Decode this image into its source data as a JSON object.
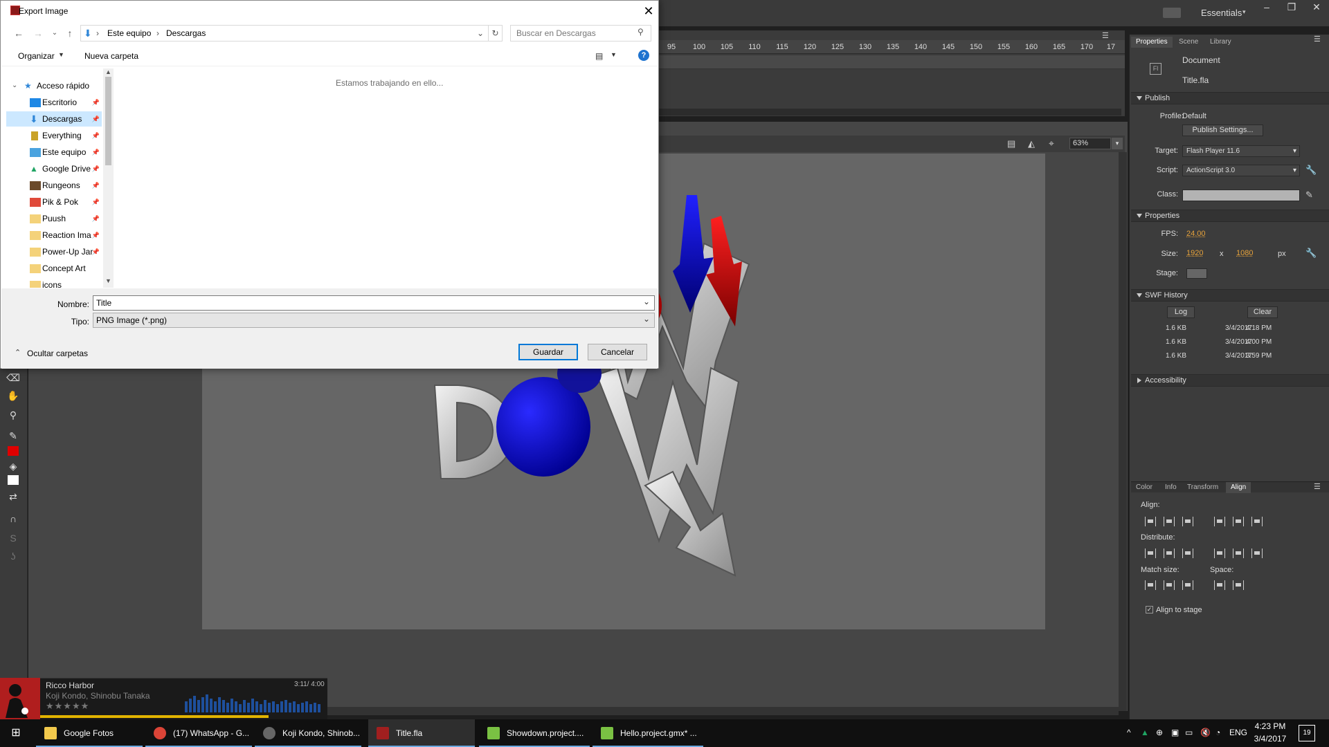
{
  "dialog": {
    "title": "Export Image",
    "breadcrumb": [
      "Este equipo",
      "Descargas"
    ],
    "search_placeholder": "Buscar en Descargas",
    "organize": "Organizar",
    "new_folder": "Nueva carpeta",
    "nav_items": [
      {
        "label": "Acceso rápido",
        "icon": "star-icon"
      },
      {
        "label": "Escritorio",
        "icon": "desktop-icon"
      },
      {
        "label": "Descargas",
        "icon": "download-icon"
      },
      {
        "label": "Everything",
        "icon": "app-icon"
      },
      {
        "label": "Este equipo",
        "icon": "computer-icon"
      },
      {
        "label": "Google Drive",
        "icon": "drive-icon"
      },
      {
        "label": "Rungeons",
        "icon": "folder-icon"
      },
      {
        "label": "Pik & Pok",
        "icon": "folder-icon"
      },
      {
        "label": "Puush",
        "icon": "folder-icon"
      },
      {
        "label": "Reaction Ima",
        "icon": "folder-icon"
      },
      {
        "label": "Power-Up Jar",
        "icon": "folder-icon"
      },
      {
        "label": "Concept Art",
        "icon": "folder-icon"
      },
      {
        "label": "icons",
        "icon": "folder-icon"
      }
    ],
    "working_text": "Estamos trabajando en ello...",
    "filename_label": "Nombre:",
    "filename_value": "Title",
    "filetype_label": "Tipo:",
    "filetype_value": "PNG Image (*.png)",
    "hide_folders": "Ocultar carpetas",
    "save": "Guardar",
    "cancel": "Cancelar"
  },
  "app": {
    "workspace": "Essentials",
    "ruler_ticks": [
      "95",
      "100",
      "105",
      "110",
      "115",
      "120",
      "125",
      "130",
      "135",
      "140",
      "145",
      "150",
      "155",
      "160",
      "165",
      "170",
      "17"
    ],
    "zoom": "63%"
  },
  "panel": {
    "tabs": [
      "Properties",
      "Scene",
      "Library"
    ],
    "doc_type": "Document",
    "doc_name": "Title.fla",
    "publish": {
      "header": "Publish",
      "profile_label": "Profile:",
      "profile_value": "Default",
      "settings_btn": "Publish Settings...",
      "target_label": "Target:",
      "target_value": "Flash Player 11.6",
      "script_label": "Script:",
      "script_value": "ActionScript 3.0",
      "class_label": "Class:"
    },
    "properties": {
      "header": "Properties",
      "fps_label": "FPS:",
      "fps_value": "24.00",
      "size_label": "Size:",
      "width": "1920",
      "x": "x",
      "height": "1080",
      "unit": "px",
      "stage_label": "Stage:"
    },
    "swf": {
      "header": "SWF History",
      "log": "Log",
      "clear": "Clear",
      "rows": [
        {
          "size": "1.6 KB",
          "date": "3/4/2017",
          "time": "4:18 PM"
        },
        {
          "size": "1.6 KB",
          "date": "3/4/2017",
          "time": "4:00 PM"
        },
        {
          "size": "1.6 KB",
          "date": "3/4/2017",
          "time": "3:59 PM"
        }
      ]
    },
    "accessibility": "Accessibility",
    "lower_tabs": [
      "Color",
      "Info",
      "Transform",
      "Align"
    ],
    "align": {
      "align_label": "Align:",
      "distribute_label": "Distribute:",
      "match_label": "Match size:",
      "space_label": "Space:",
      "to_stage": "Align to stage"
    }
  },
  "music": {
    "track": "Ricco Harbor",
    "artist": "Koji Kondo, Shinobu Tanaka",
    "time": "3:11/ 4:00",
    "rating": "★★★★★"
  },
  "taskbar": {
    "items": [
      {
        "label": "Google Fotos",
        "icon": "folder-icon",
        "color": "#f2c94c"
      },
      {
        "label": "(17) WhatsApp - G...",
        "icon": "chrome-icon",
        "color": "#db4437"
      },
      {
        "label": "Koji Kondo, Shinob...",
        "icon": "music-player-icon",
        "color": "#666666"
      },
      {
        "label": "Title.fla",
        "icon": "flash-icon",
        "color": "#a11f1f"
      },
      {
        "label": "Showdown.project....",
        "icon": "gamemaker-icon",
        "color": "#7ac143"
      },
      {
        "label": "Hello.project.gmx* ...",
        "icon": "gamemaker-icon",
        "color": "#7ac143"
      }
    ],
    "lang": "ENG",
    "time": "4:23 PM",
    "date": "3/4/2017",
    "notifications": "19"
  },
  "colors": {
    "accent_blue": "#0078d7",
    "flash_orange": "#e8a33b",
    "stage_gray": "#666666"
  }
}
